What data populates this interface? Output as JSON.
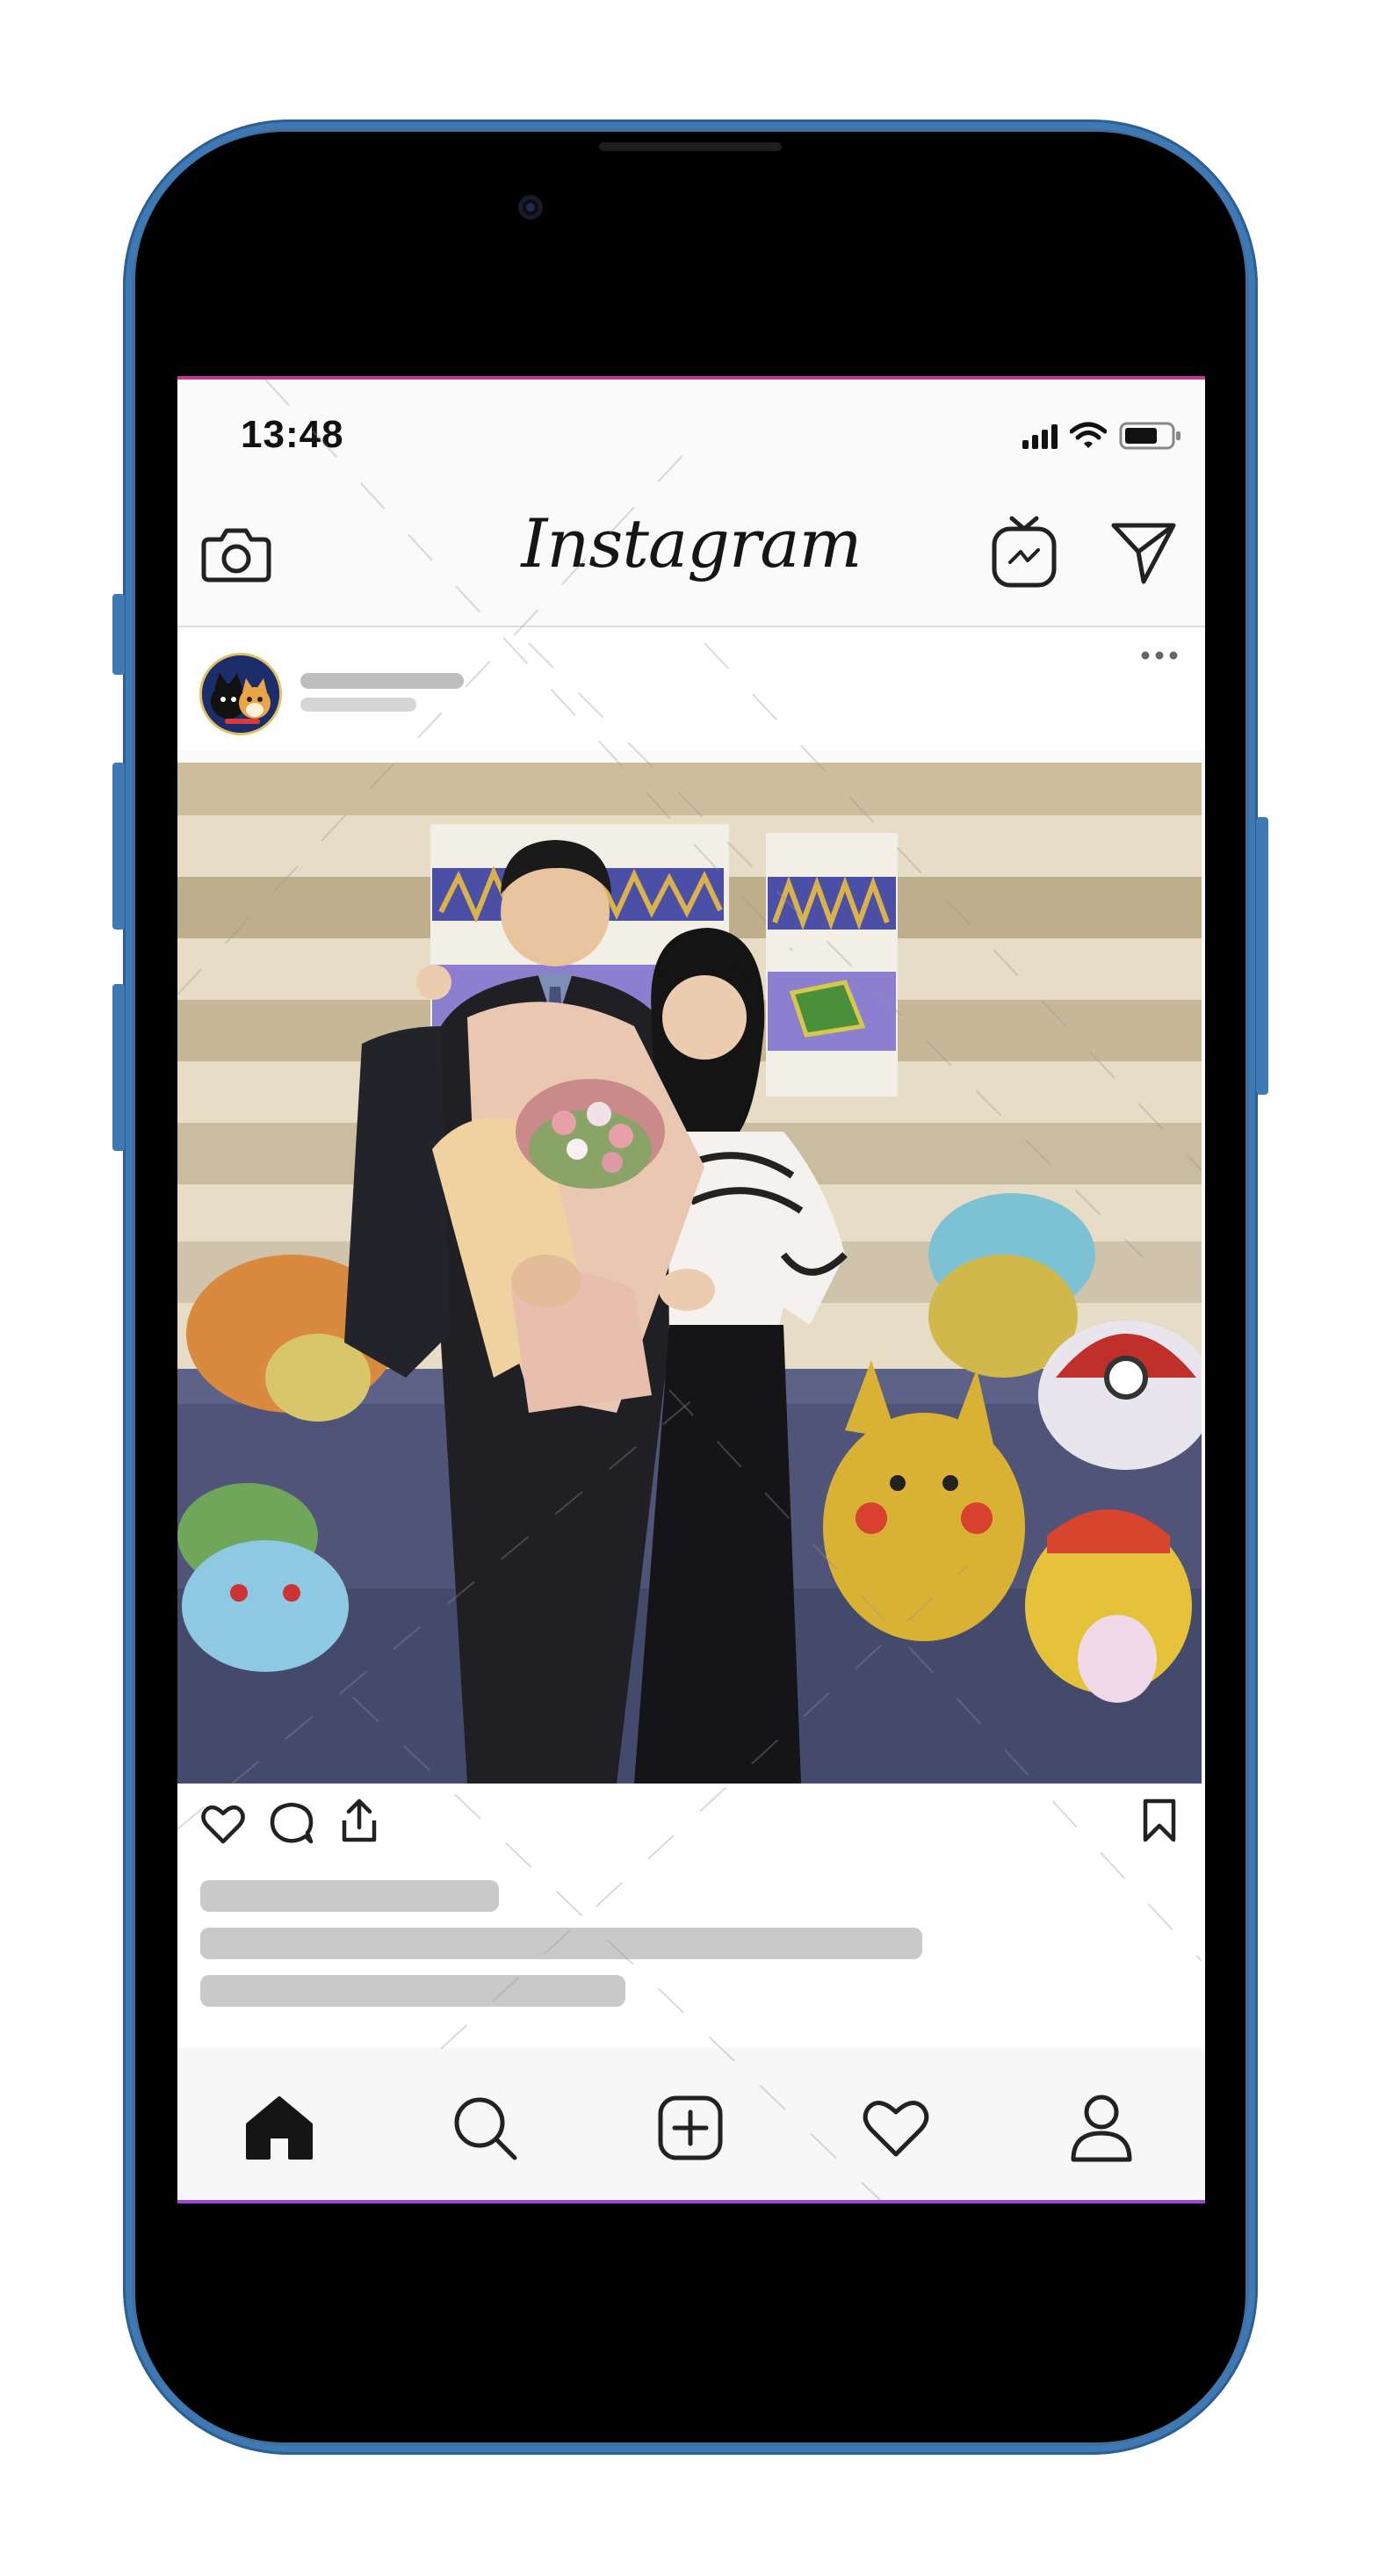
{
  "status": {
    "time": "13:48"
  },
  "header": {
    "app_name": "Instagram",
    "left_icon": "camera-icon",
    "right_icons": [
      "igtv-icon",
      "direct-message-icon"
    ]
  },
  "post": {
    "more_icon": "more-options-icon",
    "actions": [
      "like-icon",
      "comment-icon",
      "share-icon"
    ],
    "save_icon": "bookmark-icon"
  },
  "tab_bar": {
    "items": [
      "home-icon",
      "search-icon",
      "new-post-icon",
      "activity-icon",
      "profile-icon"
    ]
  },
  "colors": {
    "frame": "#3f79b3",
    "top_accent": "#c03b8f",
    "bottom_accent": "#9b4ad0",
    "skeleton": "#c9c9c9"
  }
}
